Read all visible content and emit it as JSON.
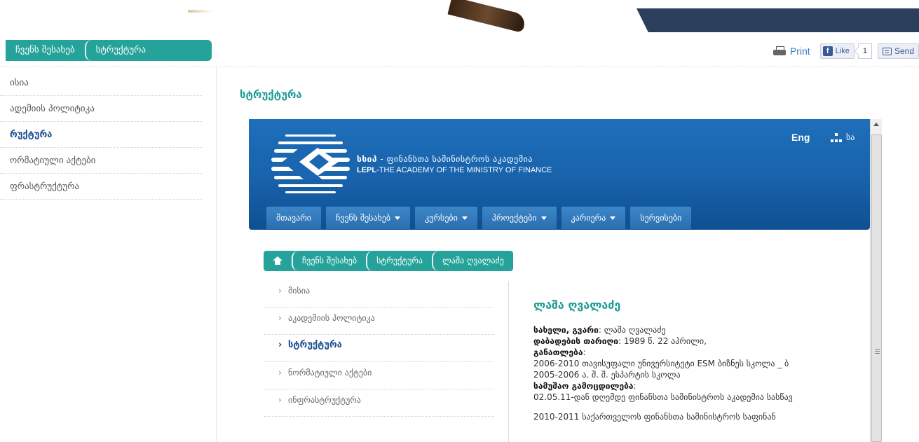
{
  "outer_breadcrumb": [
    "ჩვენს შესახებ",
    "სტრუქტურა"
  ],
  "tools": {
    "print_label": "Print",
    "like_label": "Like",
    "like_count": "1",
    "send_label": "Send"
  },
  "sidebar": {
    "items": [
      {
        "label": "ისია"
      },
      {
        "label": "ადემიის პოლიტიკა"
      },
      {
        "label": "რუქტურა"
      },
      {
        "label": "ორმატიული აქტები"
      },
      {
        "label": "ფრასტრუქტურა"
      }
    ]
  },
  "page_title": "სტრუქტურა",
  "frame": {
    "logo_ka_bold": "სსიპ",
    "logo_ka_rest": " - ფინანსთა სამინისტროს აკადემია",
    "logo_en_bold": "LEPL",
    "logo_en_rest": "-THE ACADEMY OF THE MINISTRY OF FINANCE",
    "lang_label": "Eng",
    "sitemap_trunc": "სა",
    "menu": [
      {
        "label": "მთავარი"
      },
      {
        "label": "ჩვენს შესახებ"
      },
      {
        "label": "კურსები"
      },
      {
        "label": "პროექტები"
      },
      {
        "label": "კარიერა"
      },
      {
        "label": "სერვისები"
      }
    ],
    "breadcrumb": [
      "ჩვენს შესახებ",
      "სტრუქტურა",
      "ლაშა ღვალაძე"
    ],
    "side_nav": [
      {
        "label": "მისია"
      },
      {
        "label": "აკადემიის პოლიტიკა"
      },
      {
        "label": "სტრუქტურა"
      },
      {
        "label": "ნორმატიული აქტები"
      },
      {
        "label": "ინფრასტრუქტურა"
      }
    ],
    "profile": {
      "name": "ლაშა ღვალაძე",
      "name_label": "სახელი, გვარი",
      "name_value": ": ლაშა ღვალაძე",
      "birth_label": "დაბადების თარიღი",
      "birth_value": ": 1989 წ. 22 აპრილი,",
      "education_label": "განათლება",
      "education_colon": ":",
      "education_1": "2006-2010 თავისუფალი უნივერსიტეტი ESM ბიზნეს სკოლა _ ბ",
      "education_2": "2005-2006 ა. შ. შ. ესპარტის სკოლა",
      "experience_label": "სამუშაო გამოცდილება",
      "experience_colon": ":",
      "experience_1": "02.05.11-დან დღემდე ფინანსთა სამინისტროს აკადემია სასწავ",
      "experience_2": "2010-2011 საქართველოს ფინანსთა სამინისტროს საფინან"
    }
  }
}
